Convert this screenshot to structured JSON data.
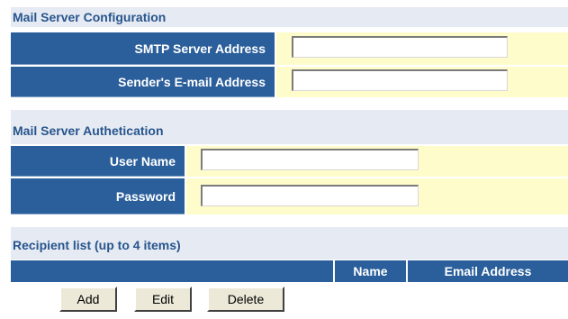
{
  "mail_server_config": {
    "heading": "Mail Server Configuration",
    "smtp_label": "SMTP Server Address",
    "smtp_value": "",
    "sender_label": "Sender's E-mail Address",
    "sender_value": ""
  },
  "mail_server_auth": {
    "heading": "Mail Server Authetication",
    "user_label": "User Name",
    "user_value": "",
    "password_label": "Password",
    "password_value": ""
  },
  "recipients": {
    "heading": "Recipient list (up to 4 items)",
    "columns": [
      "Name",
      "Email Address"
    ],
    "rows": []
  },
  "buttons": {
    "add": "Add",
    "edit": "Edit",
    "delete": "Delete"
  },
  "colors": {
    "section_bg": "#e6eaf2",
    "section_text": "#27558d",
    "label_bg": "#2b5f9b",
    "value_bg": "#fffccc"
  }
}
